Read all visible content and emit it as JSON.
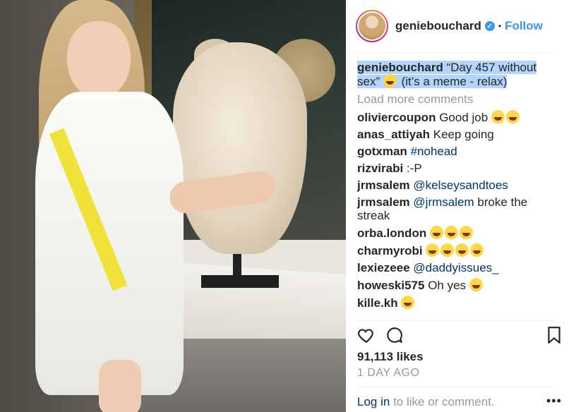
{
  "post": {
    "username": "geniebouchard",
    "verified_symbol": "✓",
    "separator": "•",
    "follow_label": "Follow"
  },
  "caption": {
    "username": "geniebouchard",
    "text_before": "“Day 457 without sex”",
    "text_after": "(it’s a meme - relax)"
  },
  "load_more": "Load more comments",
  "comments": [
    {
      "user": "oliviercoupon",
      "text": "Good job",
      "emoji_count": 2
    },
    {
      "user": "anas_attiyah",
      "text": "Keep going",
      "emoji_count": 0
    },
    {
      "user": "gotxman",
      "text": "#nohead",
      "mention": true,
      "emoji_count": 0
    },
    {
      "user": "rizvirabi",
      "text": ":-P",
      "emoji_count": 0
    },
    {
      "user": "jrmsalem",
      "text": "@kelseysandtoes",
      "mention": true,
      "emoji_count": 0
    },
    {
      "user": "jrmsalem",
      "text_mention": "@jrmsalem",
      "text": "broke the streak",
      "emoji_count": 0
    },
    {
      "user": "orba.london",
      "text": "",
      "emoji_count": 3
    },
    {
      "user": "charmyrobi",
      "text": "",
      "emoji_count": 4
    },
    {
      "user": "lexiezeee",
      "text": "@daddyissues_",
      "mention": true,
      "emoji_count": 0
    },
    {
      "user": "howeski575",
      "text": "Oh yes",
      "emoji_count": 1
    },
    {
      "user": "kille.kh",
      "text": "",
      "emoji_count": 1
    }
  ],
  "likes": "91,113 likes",
  "time_ago": "1 DAY AGO",
  "footer": {
    "login": "Log in",
    "rest": "to like or comment.",
    "more": "•••"
  },
  "colors": {
    "link": "#3897f0",
    "mention": "#003569",
    "caption_highlight": "#b3d4fc",
    "muted": "#999999"
  }
}
